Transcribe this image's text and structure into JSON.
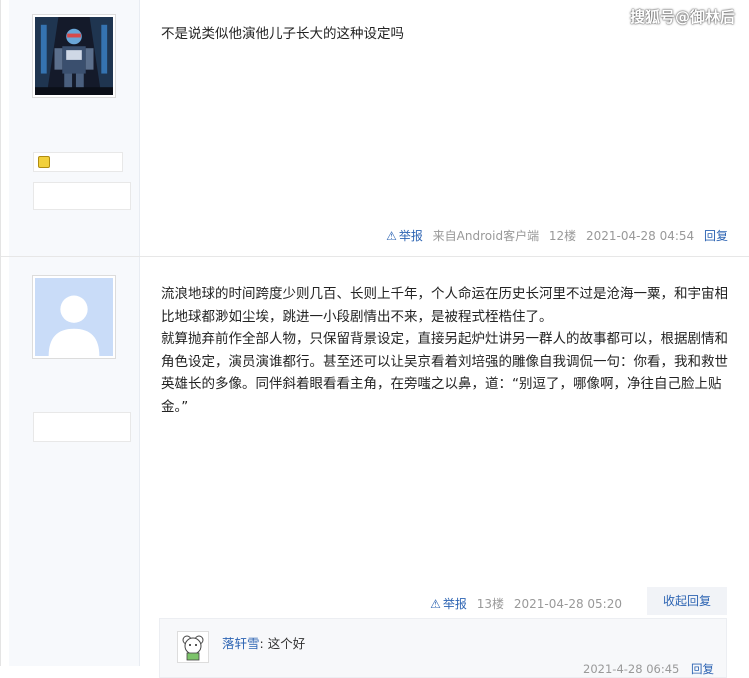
{
  "watermark": "搜狐号@御林后",
  "posts": [
    {
      "content": "不是说类似他演他儿子长大的这种设定吗",
      "report": "举报",
      "source": "来自Android客户端",
      "floor": "12楼",
      "time": "2021-04-28 04:54",
      "reply": "回复"
    },
    {
      "paragraphs": [
        "流浪地球的时间跨度少则几百、长则上千年，个人命运在历史长河里不过是沧海一粟，和宇宙相比地球都渺如尘埃，跳进一小段剧情出不来，是被程式桎梏住了。",
        "就算抛弃前作全部人物，只保留背景设定，直接另起炉灶讲另一群人的故事都可以，根据剧情和角色设定，演员演谁都行。甚至还可以让吴京看着刘培强的雕像自我调侃一句：你看，我和救世英雄长的多像。同伴斜着眼看看主角，在旁嗤之以鼻，道：“别逗了，哪像啊，净往自己脸上贴金。”"
      ],
      "report": "举报",
      "floor": "13楼",
      "time": "2021-04-28 05:20",
      "collapse": "收起回复",
      "sub_reply": {
        "user": "落轩雪",
        "separator": ":",
        "text": "这个好",
        "time": "2021-4-28 06:45",
        "reply": "回复"
      }
    }
  ]
}
